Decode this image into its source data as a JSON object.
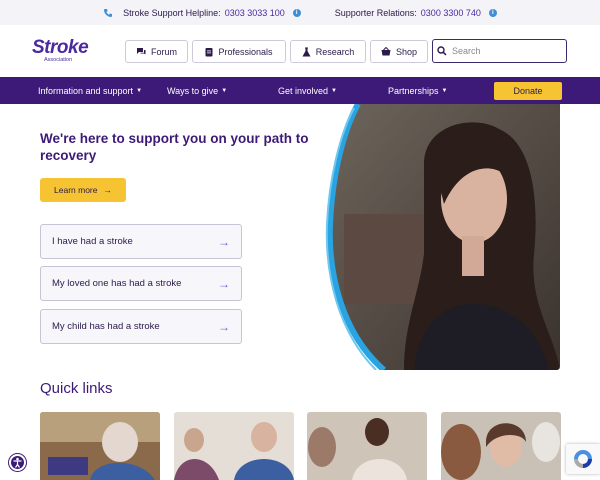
{
  "topbar": {
    "helpline_label": "Stroke Support Helpline:",
    "helpline_number": "0303 3033 100",
    "relations_label": "Supporter Relations:",
    "relations_number": "0300 3300 740"
  },
  "logo": {
    "word": "Stroke",
    "sub": "Association"
  },
  "header": {
    "buttons": [
      {
        "label": "Forum",
        "icon": "chat-icon"
      },
      {
        "label": "Professionals",
        "icon": "clipboard-icon"
      },
      {
        "label": "Research",
        "icon": "flask-icon"
      },
      {
        "label": "Shop",
        "icon": "basket-icon"
      }
    ],
    "search_placeholder": "Search"
  },
  "nav": {
    "items": [
      "Information and support",
      "Ways to give",
      "Get involved",
      "Partnerships"
    ],
    "donate": "Donate"
  },
  "hero": {
    "heading": "We're here to support you on your path to recovery",
    "learn_more": "Learn more",
    "choices": [
      "I have had a stroke",
      "My loved one has had a stroke",
      "My child has had a stroke"
    ]
  },
  "quick_links": {
    "title": "Quick links"
  },
  "colors": {
    "brand_purple": "#3d1a78",
    "accent_yellow": "#f6c432",
    "info_blue": "#3f8fd4",
    "arrow_purple": "#7a4fd0"
  }
}
